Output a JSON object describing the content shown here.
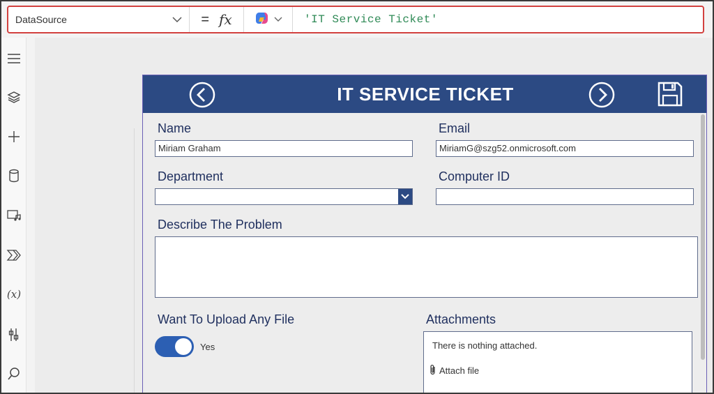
{
  "formula_bar": {
    "property": "DataSource",
    "equals": "=",
    "fx": "fx",
    "formula": "'IT Service Ticket'"
  },
  "rail": {
    "items": [
      "hamburger-menu-icon",
      "layers-icon",
      "plus-icon",
      "database-icon",
      "media-icon",
      "power-automate-icon",
      "variables-icon",
      "tools-icon",
      "search-icon"
    ],
    "variables_label": "(x)"
  },
  "form": {
    "title": "IT SERVICE TICKET",
    "name_label": "Name",
    "name_value": "Miriam Graham",
    "email_label": "Email",
    "email_value": "MiriamG@szg52.onmicrosoft.com",
    "department_label": "Department",
    "department_value": "",
    "computer_id_label": "Computer ID",
    "computer_id_value": "",
    "problem_label": "Describe The Problem",
    "problem_value": "",
    "upload_label": "Want To Upload Any File",
    "toggle_state": "Yes",
    "attachments_label": "Attachments",
    "attachments_empty": "There is nothing attached.",
    "attach_file": "Attach file"
  },
  "colors": {
    "header": "#2c4a83",
    "label": "#1f2f5e",
    "formula_border": "#d2413f",
    "formula_text": "#2f8a56",
    "toggle": "#2c5fb3"
  }
}
